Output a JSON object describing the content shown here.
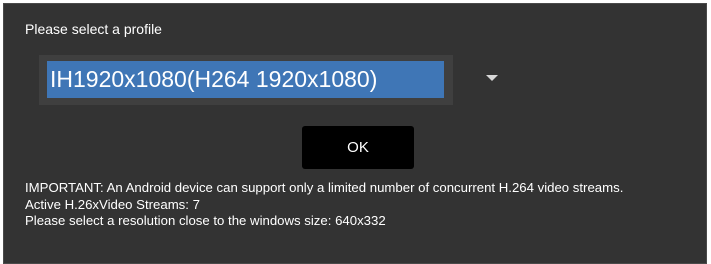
{
  "dialog": {
    "prompt": "Please select a profile",
    "profile_select": {
      "selected": "IH1920x1080(H264 1920x1080)",
      "highlight_color": "#3f76b6",
      "icon": "chevron-down-icon"
    },
    "ok_label": "OK",
    "notes": {
      "important": "IMPORTANT: An Android device can support only a limited number of concurrent H.264 video streams.",
      "active_streams": "Active H.26xVideo Streams: 7",
      "resolution_hint": "Please select a resolution close to the windows size: 640x332"
    }
  }
}
